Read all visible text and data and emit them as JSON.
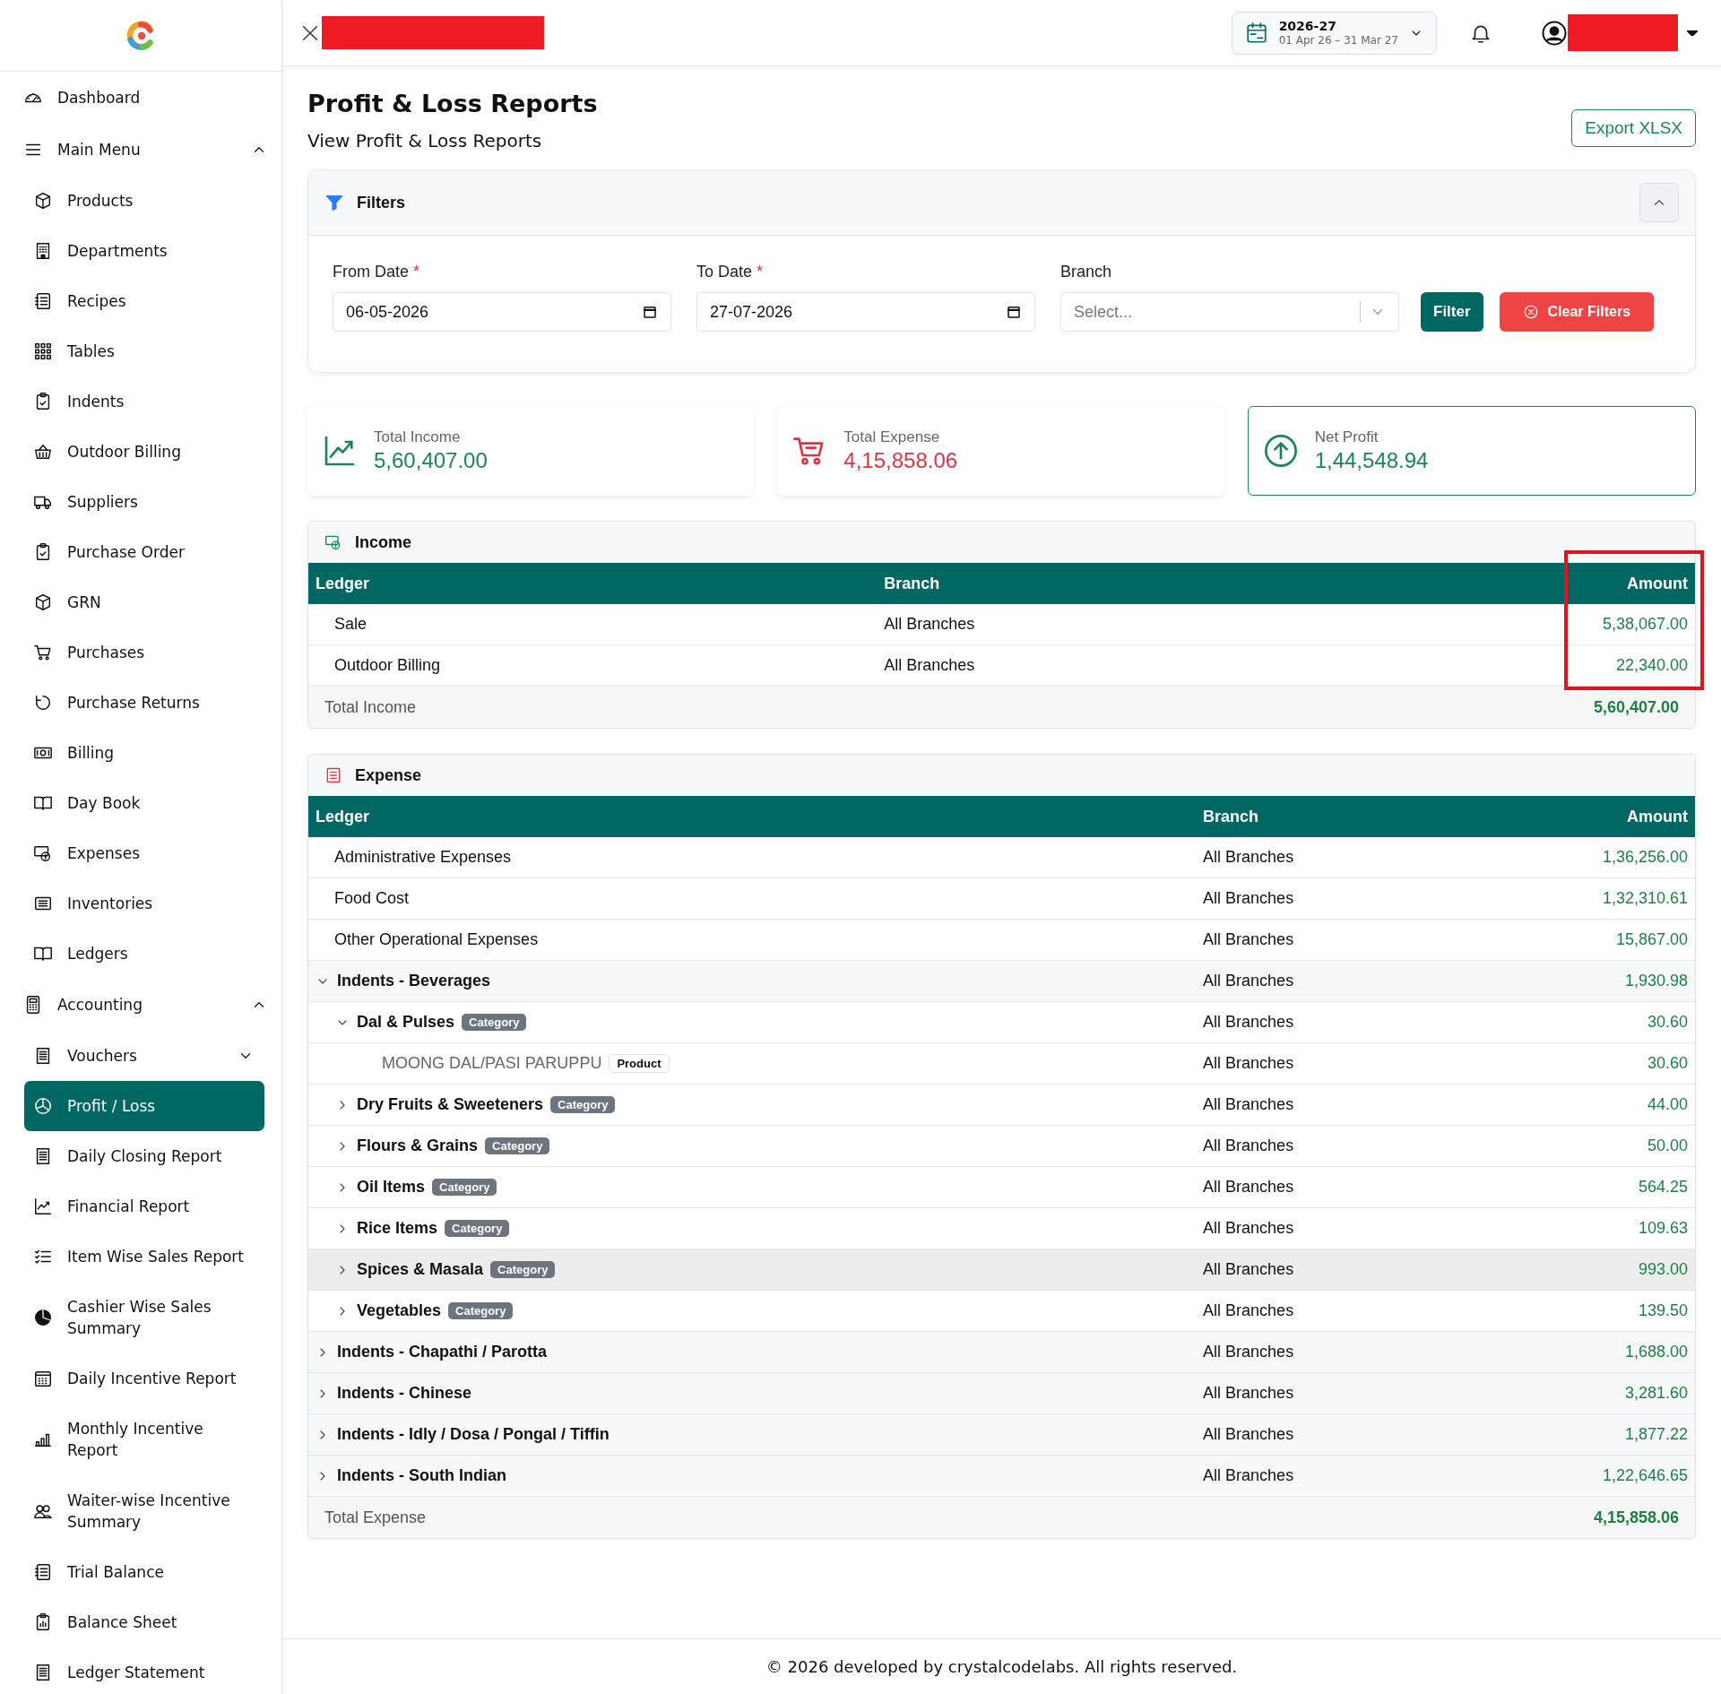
{
  "header": {
    "title_redacted": true,
    "fiscal_year": {
      "label": "2026-27",
      "range": "01 Apr 26 – 31 Mar 27"
    },
    "user_redacted": true
  },
  "sidebar": {
    "items": [
      {
        "label": "Dashboard",
        "selected": false
      },
      {
        "label": "Main Menu",
        "selected": false,
        "expanded": true,
        "children": [
          {
            "label": "Products",
            "selected": false
          },
          {
            "label": "Departments",
            "selected": false
          },
          {
            "label": "Recipes",
            "selected": false
          },
          {
            "label": "Tables",
            "selected": false
          },
          {
            "label": "Indents",
            "selected": false
          },
          {
            "label": "Outdoor Billing",
            "selected": false
          },
          {
            "label": "Suppliers",
            "selected": false
          },
          {
            "label": "Purchase Order",
            "selected": false
          },
          {
            "label": "GRN",
            "selected": false
          },
          {
            "label": "Purchases",
            "selected": false
          },
          {
            "label": "Purchase Returns",
            "selected": false
          },
          {
            "label": "Billing",
            "selected": false
          },
          {
            "label": "Day Book",
            "selected": false
          },
          {
            "label": "Expenses",
            "selected": false
          },
          {
            "label": "Inventories",
            "selected": false
          },
          {
            "label": "Ledgers",
            "selected": false
          }
        ]
      },
      {
        "label": "Accounting",
        "selected": false,
        "expanded": true,
        "children": [
          {
            "label": "Vouchers",
            "selected": false,
            "expanded": false
          },
          {
            "label": "Profit / Loss",
            "selected": true
          },
          {
            "label": "Daily Closing Report",
            "selected": false
          },
          {
            "label": "Financial Report",
            "selected": false
          },
          {
            "label": "Item Wise Sales Report",
            "selected": false
          },
          {
            "label": "Cashier Wise Sales Summary",
            "selected": false
          },
          {
            "label": "Daily Incentive Report",
            "selected": false
          },
          {
            "label": "Monthly Incentive Report",
            "selected": false
          },
          {
            "label": "Waiter-wise Incentive Summary",
            "selected": false
          },
          {
            "label": "Trial Balance",
            "selected": false
          },
          {
            "label": "Balance Sheet",
            "selected": false
          },
          {
            "label": "Ledger Statement",
            "selected": false
          }
        ]
      }
    ]
  },
  "page": {
    "title": "Profit & Loss Reports",
    "subtitle": "View Profit & Loss Reports",
    "export_button": "Export XLSX"
  },
  "filters": {
    "title": "Filters",
    "expanded": true,
    "fields": [
      {
        "kind": "date",
        "label": "From Date",
        "required_mark": "*",
        "value": "06-05-2026"
      },
      {
        "kind": "date",
        "label": "To Date",
        "required_mark": "*",
        "value": "27-07-2026"
      },
      {
        "kind": "select",
        "label": "Branch",
        "placeholder": "Select..."
      }
    ],
    "buttons": [
      {
        "kind": "primary",
        "label": "Filter"
      },
      {
        "kind": "danger",
        "label": "Clear Filters"
      }
    ]
  },
  "summary": [
    {
      "label": "Total Income",
      "value": "5,60,407.00",
      "color": "#198754",
      "outlined": false
    },
    {
      "label": "Total Expense",
      "value": "4,15,858.06",
      "color": "#dc3545",
      "outlined": false
    },
    {
      "label": "Net Profit",
      "value": "1,44,548.94",
      "color": "#198754",
      "outlined": true
    }
  ],
  "income": {
    "title": "Income",
    "highlight_frame": true,
    "columns": [
      "Ledger",
      "Branch",
      "Amount"
    ],
    "rows": [
      {
        "kind": "ledger",
        "ledger": "Sale",
        "branch": "All Branches",
        "amount": "5,38,067.00"
      },
      {
        "kind": "ledger",
        "ledger": "Outdoor Billing",
        "branch": "All Branches",
        "amount": "22,340.00"
      }
    ],
    "total": {
      "label": "Total Income",
      "value": "5,60,407.00"
    }
  },
  "expense": {
    "title": "Expense",
    "columns": [
      "Ledger",
      "Branch",
      "Amount"
    ],
    "rows": [
      {
        "kind": "ledger",
        "ledger": "Administrative Expenses",
        "branch": "All Branches",
        "amount": "1,36,256.00"
      },
      {
        "kind": "ledger",
        "ledger": "Food Cost",
        "branch": "All Branches",
        "amount": "1,32,310.61"
      },
      {
        "kind": "ledger",
        "ledger": "Other Operational Expenses",
        "branch": "All Branches",
        "amount": "15,867.00"
      },
      {
        "kind": "group",
        "ledger": "Indents - Beverages",
        "branch": "All Branches",
        "amount": "1,930.98",
        "expanded": true,
        "hovered": false,
        "children": [
          {
            "kind": "category",
            "ledger": "Dal & Pulses",
            "badge": "Category",
            "branch": "All Branches",
            "amount": "30.60",
            "expanded": true,
            "hovered": false,
            "children": [
              {
                "kind": "product",
                "ledger": "MOONG DAL/PASI PARUPPU",
                "badge": "Product",
                "branch": "All Branches",
                "amount": "30.60"
              }
            ]
          },
          {
            "kind": "category",
            "ledger": "Dry Fruits & Sweeteners",
            "badge": "Category",
            "branch": "All Branches",
            "amount": "44.00",
            "expanded": false,
            "hovered": false
          },
          {
            "kind": "category",
            "ledger": "Flours & Grains",
            "badge": "Category",
            "branch": "All Branches",
            "amount": "50.00",
            "expanded": false,
            "hovered": false
          },
          {
            "kind": "category",
            "ledger": "Oil Items",
            "badge": "Category",
            "branch": "All Branches",
            "amount": "564.25",
            "expanded": false,
            "hovered": false
          },
          {
            "kind": "category",
            "ledger": "Rice Items",
            "badge": "Category",
            "branch": "All Branches",
            "amount": "109.63",
            "expanded": false,
            "hovered": false
          },
          {
            "kind": "category",
            "ledger": "Spices & Masala",
            "badge": "Category",
            "branch": "All Branches",
            "amount": "993.00",
            "expanded": false,
            "hovered": true
          },
          {
            "kind": "category",
            "ledger": "Vegetables",
            "badge": "Category",
            "branch": "All Branches",
            "amount": "139.50",
            "expanded": false,
            "hovered": false
          }
        ]
      },
      {
        "kind": "group",
        "ledger": "Indents - Chapathi / Parotta",
        "branch": "All Branches",
        "amount": "1,688.00",
        "expanded": false,
        "hovered": false
      },
      {
        "kind": "group",
        "ledger": "Indents - Chinese",
        "branch": "All Branches",
        "amount": "3,281.60",
        "expanded": false,
        "hovered": false
      },
      {
        "kind": "group",
        "ledger": "Indents - Idly / Dosa / Pongal / Tiffin",
        "branch": "All Branches",
        "amount": "1,877.22",
        "expanded": false,
        "hovered": false
      },
      {
        "kind": "group",
        "ledger": "Indents - South Indian",
        "branch": "All Branches",
        "amount": "1,22,646.65",
        "expanded": false,
        "hovered": false
      }
    ],
    "total": {
      "label": "Total Expense",
      "value": "4,15,858.06"
    }
  },
  "footer": "© 2026 developed by crystalcodelabs. All rights reserved."
}
